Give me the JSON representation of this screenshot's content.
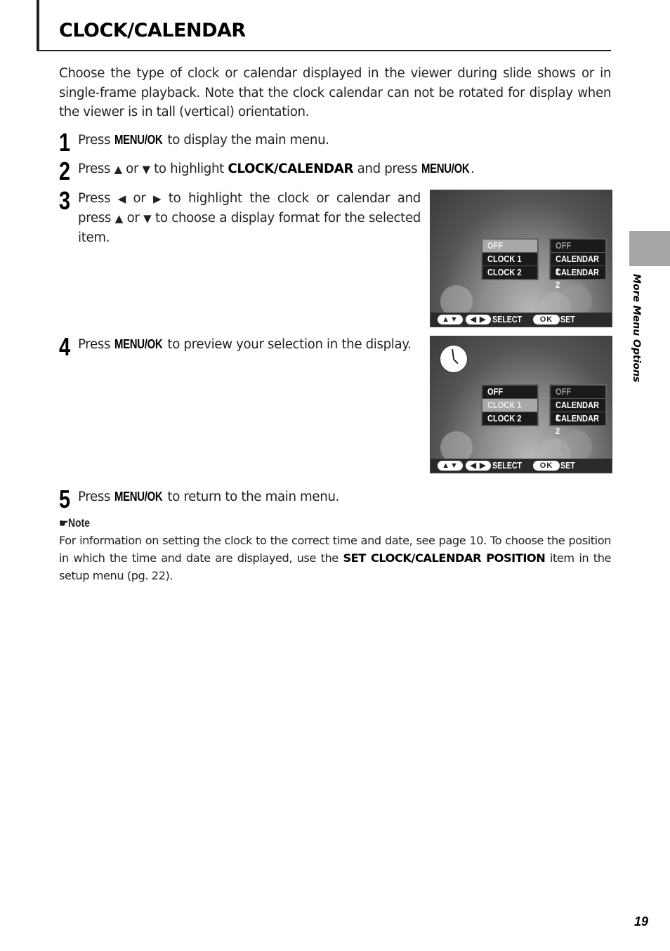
{
  "header": {
    "title": "CLOCK/CALENDAR"
  },
  "intro": "Choose the type of clock or calendar displayed in the viewer during slide shows or in single-frame playback.  Note that the clock calendar can not be rotated for display when the viewer is in tall (vertical) orientation.",
  "steps": [
    {
      "num": "1",
      "pre": "Press ",
      "key": "MENU/OK",
      "post": " to display the main menu."
    },
    {
      "num": "2",
      "pre": "Press ",
      "up": "▲",
      "or": " or ",
      "down": "▼",
      "mid": " to highlight ",
      "item": "CLOCK/CALENDAR",
      "mid2": " and press ",
      "key": "MENU/OK",
      "post": "."
    },
    {
      "num": "3",
      "pre": "Press ",
      "left": "◀",
      "or": " or ",
      "right": "▶",
      "mid": " to highlight the clock or calendar and press ",
      "up": "▲",
      "down": "▼",
      "post": " to choose a display format for the selected item."
    },
    {
      "num": "4",
      "pre": "Press ",
      "key": "MENU/OK",
      "post": " to preview your selection in the display."
    },
    {
      "num": "5",
      "pre": "Press ",
      "key": "MENU/OK",
      "post": " to return to the main menu."
    }
  ],
  "screens": [
    {
      "clock_columns": [
        "OFF",
        "CLOCK 1",
        "CLOCK 2"
      ],
      "calendar_columns": [
        "OFF",
        "CALENDAR 1",
        "CALENDAR 2"
      ],
      "clock_selected": "OFF",
      "calendar_selected": "OFF",
      "show_clock_preview": false
    },
    {
      "clock_columns": [
        "OFF",
        "CLOCK 1",
        "CLOCK 2"
      ],
      "calendar_columns": [
        "OFF",
        "CALENDAR 1",
        "CALENDAR 2"
      ],
      "clock_selected": "CLOCK 1",
      "calendar_selected": "OFF",
      "show_clock_preview": true
    }
  ],
  "lcd_bar": {
    "nav_ud": "▲▼",
    "nav_lr": "◀ ▶",
    "select": "SELECT",
    "ok": "OK",
    "set": "SET"
  },
  "note": {
    "icon": "pointing-hand",
    "label": "Note",
    "body_pre": "For information on setting the clock to the correct time and date, see page 10.  To choose the position in which the time and date are displayed, use the ",
    "body_bold": "SET CLOCK/CALENDAR POSITION",
    "body_post": " item in the setup menu (pg. 22)."
  },
  "side_tab": {
    "label": "More Menu Options"
  },
  "page_number": "19"
}
